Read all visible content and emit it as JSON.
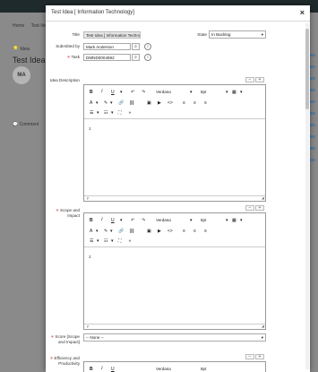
{
  "background": {
    "breadcrumb": [
      "Home",
      "Test Ide"
    ],
    "idea_label": "Idea",
    "idea_title": "Test Idea [",
    "avatar_initials": "MA",
    "comment_label": "Comment"
  },
  "modal": {
    "title": "Test Idea [ Information Technology]",
    "close_label": "×"
  },
  "form": {
    "title_label": "Title",
    "title_value": "Test Idea [ Information Techno",
    "state_label": "State",
    "state_value": "In Backlog",
    "submitted_by_label": "Submitted by",
    "submitted_by_value": "Mark Anderson",
    "task_label": "Task",
    "task_value": "DMND0004692",
    "idea_description_label": "Idea Description",
    "idea_description_text": "1",
    "idea_description_status": "p",
    "scope_label": "Scope and Impact",
    "scope_text": "2",
    "scope_status": "p",
    "score_label": "Score [Scope and Impact]",
    "score_value": "-- None --",
    "efficiency_label": "Efficiency and Productivity"
  },
  "toolbar": {
    "bold": "B",
    "italic": "I",
    "underline": "U",
    "font_family": "Verdana",
    "font_size": "8pt",
    "undo": "↶",
    "redo": "↷"
  },
  "collapse_controls": {
    "minus": "−",
    "plus": "+"
  }
}
